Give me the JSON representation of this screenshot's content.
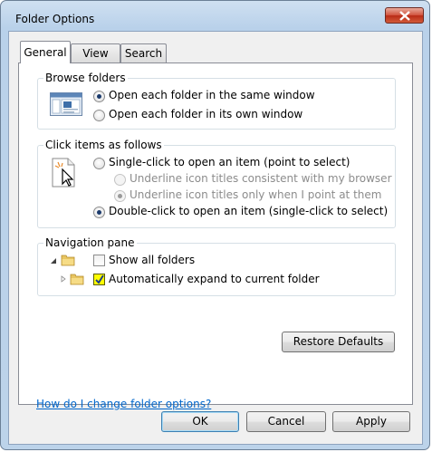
{
  "window": {
    "title": "Folder Options"
  },
  "tabs": [
    {
      "label": "General",
      "selected": true
    },
    {
      "label": "View",
      "selected": false
    },
    {
      "label": "Search",
      "selected": false
    }
  ],
  "browse_folders": {
    "heading": "Browse folders",
    "options": [
      {
        "label": "Open each folder in the same window",
        "checked": true
      },
      {
        "label": "Open each folder in its own window",
        "checked": false
      }
    ]
  },
  "click_items": {
    "heading": "Click items as follows",
    "single_click": {
      "label": "Single-click to open an item (point to select)",
      "checked": false
    },
    "underline_consistent": {
      "label": "Underline icon titles consistent with my browser",
      "checked": false,
      "enabled": false
    },
    "underline_point": {
      "label": "Underline icon titles only when I point at them",
      "checked": true,
      "enabled": false
    },
    "double_click": {
      "label": "Double-click to open an item (single-click to select)",
      "checked": true
    }
  },
  "navigation_pane": {
    "heading": "Navigation pane",
    "show_all_folders": {
      "label": "Show all folders",
      "checked": false
    },
    "auto_expand": {
      "label": "Automatically expand to current folder",
      "checked": true
    }
  },
  "restore_defaults": "Restore Defaults",
  "help_link": "How do I change folder options?",
  "buttons": {
    "ok": "OK",
    "cancel": "Cancel",
    "apply": "Apply"
  },
  "colors": {
    "link": "#0066cc",
    "checkbox_highlight": "#ffff00",
    "radio_dot": "#1b3a6c"
  },
  "icons": [
    "close-icon",
    "window-icon",
    "cursor-click-icon",
    "expand-arrow-icon",
    "folder-icon",
    "checkmark-icon"
  ]
}
